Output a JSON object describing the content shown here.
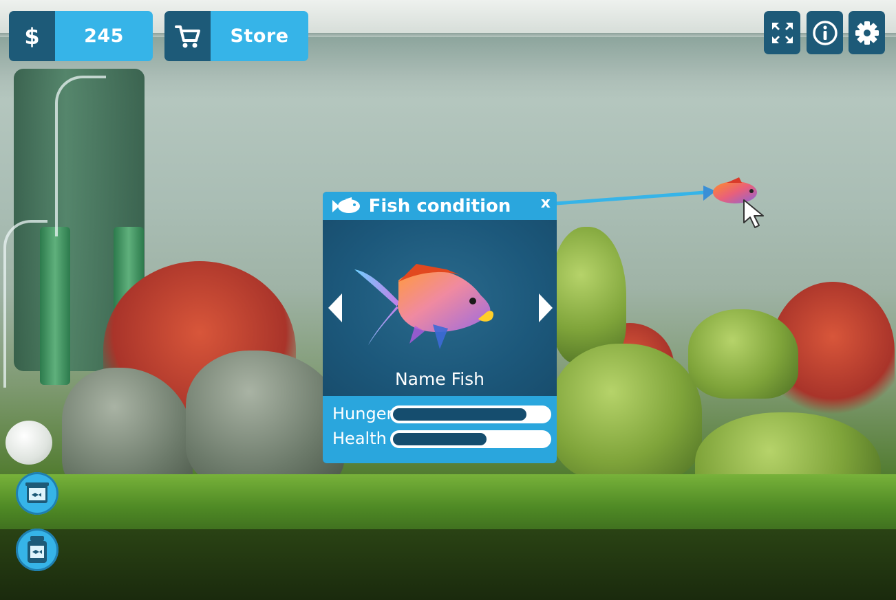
{
  "hud": {
    "money_icon": "dollar-icon",
    "money_value": "245",
    "store_icon": "cart-icon",
    "store_label": "Store"
  },
  "top_right_buttons": [
    {
      "icon": "fullscreen-icon"
    },
    {
      "icon": "info-icon"
    },
    {
      "icon": "gear-icon"
    }
  ],
  "side_buttons": [
    {
      "icon": "aquarium-icon"
    },
    {
      "icon": "fish-food-jar-icon"
    }
  ],
  "panel": {
    "title": "Fish condition",
    "close_label": "x",
    "title_icon": "fish-icon",
    "fish_name": "Name Fish",
    "stats": [
      {
        "label": "Hunger",
        "value": 0.86
      },
      {
        "label": "Health",
        "value": 0.6
      }
    ]
  },
  "colors": {
    "accent": "#36b4e8",
    "dark": "#1d5a78",
    "panel_header": "#2aa6dd",
    "bar_fill": "#154d6e"
  }
}
